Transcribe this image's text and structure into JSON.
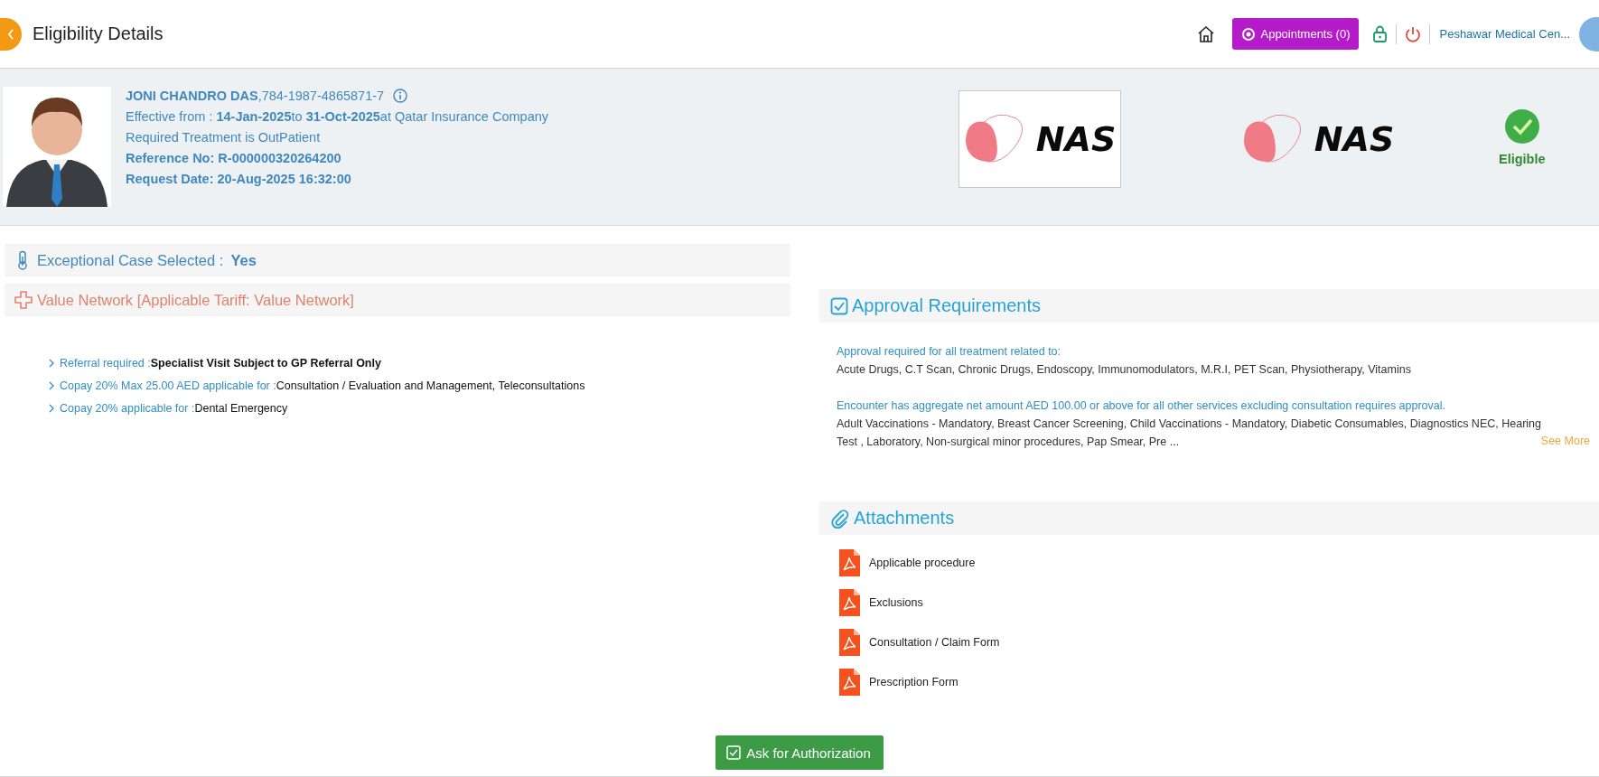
{
  "header": {
    "title": "Eligibility Details",
    "appointments_button": "Appointments (0)",
    "facility": "Peshawar Medical Cen..."
  },
  "patient": {
    "identity": "**JONI CHANDRO DAS**,784-1987-4865871-7",
    "effective": "Effective from : **14-Jan-2025**to **31-Oct-2025**at Qatar Insurance Company",
    "treatment": "Required Treatment is OutPatient",
    "reference": "Reference No: R-000000320264200",
    "request_date": "Request Date: 20-Aug-2025 16:32:00"
  },
  "logos": [
    {
      "text": "NAS",
      "boxed": true
    },
    {
      "text": "NAS",
      "boxed": false
    }
  ],
  "status": {
    "label": "Eligible",
    "eligible": true
  },
  "exceptional_case": {
    "label": "Exceptional Case Selected :",
    "value": "Yes"
  },
  "network": {
    "title": "Value Network [Applicable Tariff: Value Network]"
  },
  "benefits": [
    {
      "label": "Referral required :",
      "value": "Specialist Visit Subject to GP Referral Only",
      "emphasis": true
    },
    {
      "label": "Copay 20% Max 25.00 AED applicable for :",
      "value": "Consultation / Evaluation and Management, Teleconsultations",
      "emphasis": false
    },
    {
      "label": "Copay 20% applicable for :",
      "value": "Dental Emergency",
      "emphasis": false
    }
  ],
  "approval": {
    "title": "Approval Requirements",
    "groups": [
      {
        "heading": "Approval required for all treatment related to:",
        "items": "Acute Drugs, C.T Scan, Chronic Drugs, Endoscopy, Immunomodulators, M.R.I, PET Scan, Physiotherapy, Vitamins"
      },
      {
        "heading": "Encounter has aggregate net amount AED 100.00 or above for all other services excluding consultation requires approval.",
        "items": "Adult Vaccinations - Mandatory, Breast Cancer Screening, Child Vaccinations - Mandatory, Diabetic Consumables, Diagnostics NEC, Hearing Test , Laboratory, Non-surgical minor procedures, Pap Smear, Pre ..."
      }
    ],
    "see_more": "See More"
  },
  "attachments": {
    "title": "Attachments",
    "files": [
      "Applicable procedure",
      "Exclusions",
      "Consultation / Claim Form",
      "Prescription Form"
    ]
  },
  "action_button": "Ask for Authorization"
}
